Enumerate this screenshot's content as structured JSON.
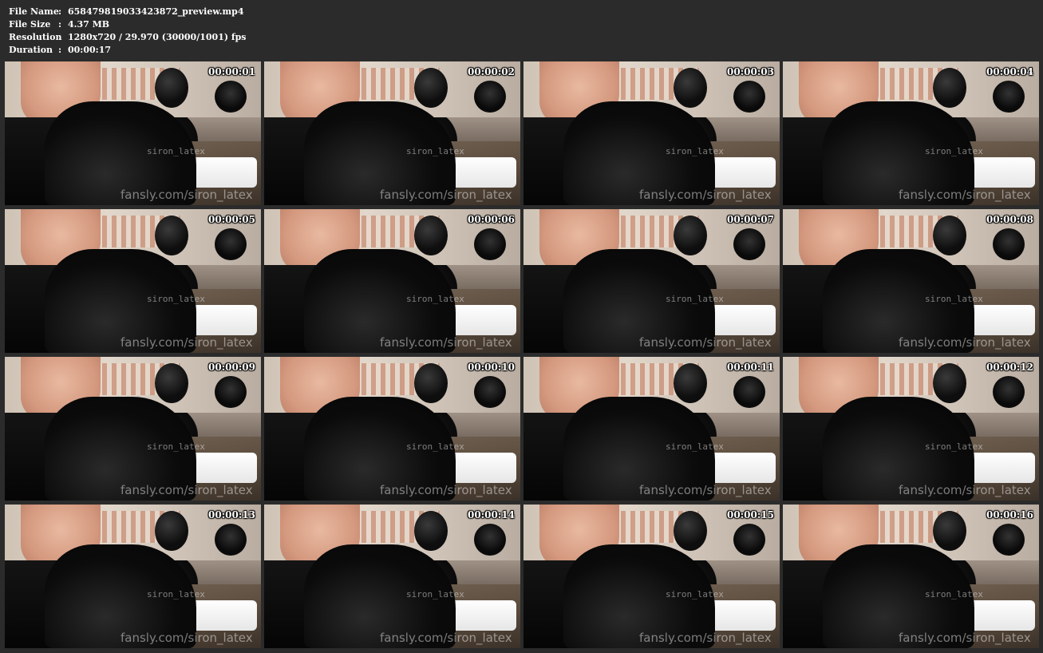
{
  "info": {
    "rows": [
      {
        "label": "File Name",
        "value": "658479819033423872_preview.mp4"
      },
      {
        "label": "File Size",
        "value": "4.37 MB"
      },
      {
        "label": "Resolution",
        "value": "1280x720 / 29.970 (30000/1001) fps"
      },
      {
        "label": "Duration",
        "value": "00:00:17"
      }
    ],
    "separator": ":"
  },
  "watermark": {
    "name": "siron_latex",
    "site": "fansly.com/siron_latex"
  },
  "thumbnails": [
    {
      "timestamp": "00:00:01"
    },
    {
      "timestamp": "00:00:02"
    },
    {
      "timestamp": "00:00:03"
    },
    {
      "timestamp": "00:00:04"
    },
    {
      "timestamp": "00:00:05"
    },
    {
      "timestamp": "00:00:06"
    },
    {
      "timestamp": "00:00:07"
    },
    {
      "timestamp": "00:00:08"
    },
    {
      "timestamp": "00:00:09"
    },
    {
      "timestamp": "00:00:10"
    },
    {
      "timestamp": "00:00:11"
    },
    {
      "timestamp": "00:00:12"
    },
    {
      "timestamp": "00:00:13"
    },
    {
      "timestamp": "00:00:14"
    },
    {
      "timestamp": "00:00:15"
    },
    {
      "timestamp": "00:00:16"
    }
  ]
}
